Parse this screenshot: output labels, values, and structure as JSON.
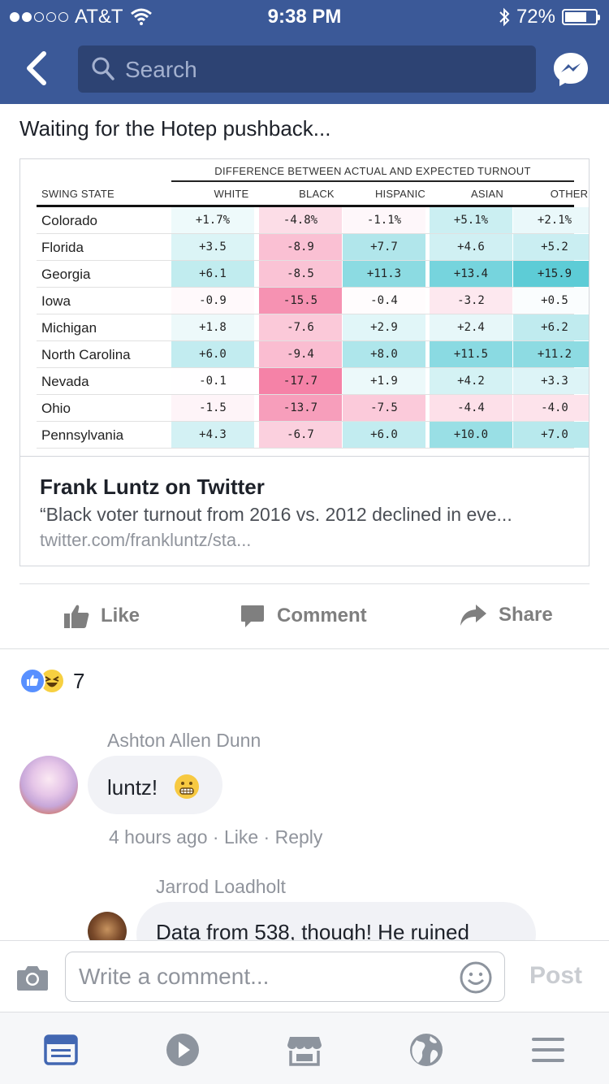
{
  "status_bar": {
    "carrier": "AT&T",
    "time": "9:38 PM",
    "battery": "72%",
    "battery_level": 0.72
  },
  "header": {
    "search_placeholder": "Search"
  },
  "post": {
    "text": "Waiting for the Hotep pushback...",
    "link_card": {
      "table": {
        "title": "DIFFERENCE BETWEEN ACTUAL AND EXPECTED TURNOUT",
        "columns": [
          "SWING STATE",
          "WHITE",
          "BLACK",
          "HISPANIC",
          "ASIAN",
          "OTHER"
        ],
        "rows": [
          {
            "state": "Colorado",
            "values": [
              "+1.7%",
              "-4.8%",
              "-1.1%",
              "+5.1%",
              "+2.1%"
            ]
          },
          {
            "state": "Florida",
            "values": [
              "+3.5",
              "-8.9",
              "+7.7",
              "+4.6",
              "+5.2"
            ]
          },
          {
            "state": "Georgia",
            "values": [
              "+6.1",
              "-8.5",
              "+11.3",
              "+13.4",
              "+15.9"
            ]
          },
          {
            "state": "Iowa",
            "values": [
              "-0.9",
              "-15.5",
              "-0.4",
              "-3.2",
              "+0.5"
            ]
          },
          {
            "state": "Michigan",
            "values": [
              "+1.8",
              "-7.6",
              "+2.9",
              "+2.4",
              "+6.2"
            ]
          },
          {
            "state": "North Carolina",
            "values": [
              "+6.0",
              "-9.4",
              "+8.0",
              "+11.5",
              "+11.2"
            ]
          },
          {
            "state": "Nevada",
            "values": [
              "-0.1",
              "-17.7",
              "+1.9",
              "+4.2",
              "+3.3"
            ]
          },
          {
            "state": "Ohio",
            "values": [
              "-1.5",
              "-13.7",
              "-7.5",
              "-4.4",
              "-4.0"
            ]
          },
          {
            "state": "Pennsylvania",
            "values": [
              "+4.3",
              "-6.7",
              "+6.0",
              "+10.0",
              "+7.0"
            ]
          }
        ]
      },
      "title": "Frank Luntz on Twitter",
      "description": "“Black voter turnout from 2016 vs. 2012 declined in eve...",
      "url": "twitter.com/frankluntz/sta..."
    },
    "actions": {
      "like": "Like",
      "comment": "Comment",
      "share": "Share"
    },
    "reaction_count": "7"
  },
  "comments": [
    {
      "author": "Ashton Allen Dunn",
      "text": "luntz!",
      "time": "4 hours ago",
      "like": "Like",
      "reply": "Reply",
      "sep": "·"
    },
    {
      "author": "Jarrod Loadholt",
      "text": "Data from 538, though!  He ruined"
    }
  ],
  "composer": {
    "placeholder": "Write a comment...",
    "post_label": "Post"
  },
  "colors": {
    "facebook_blue": "#3b5998",
    "search_bg": "#2d4373",
    "tab_active": "#4267b2"
  }
}
